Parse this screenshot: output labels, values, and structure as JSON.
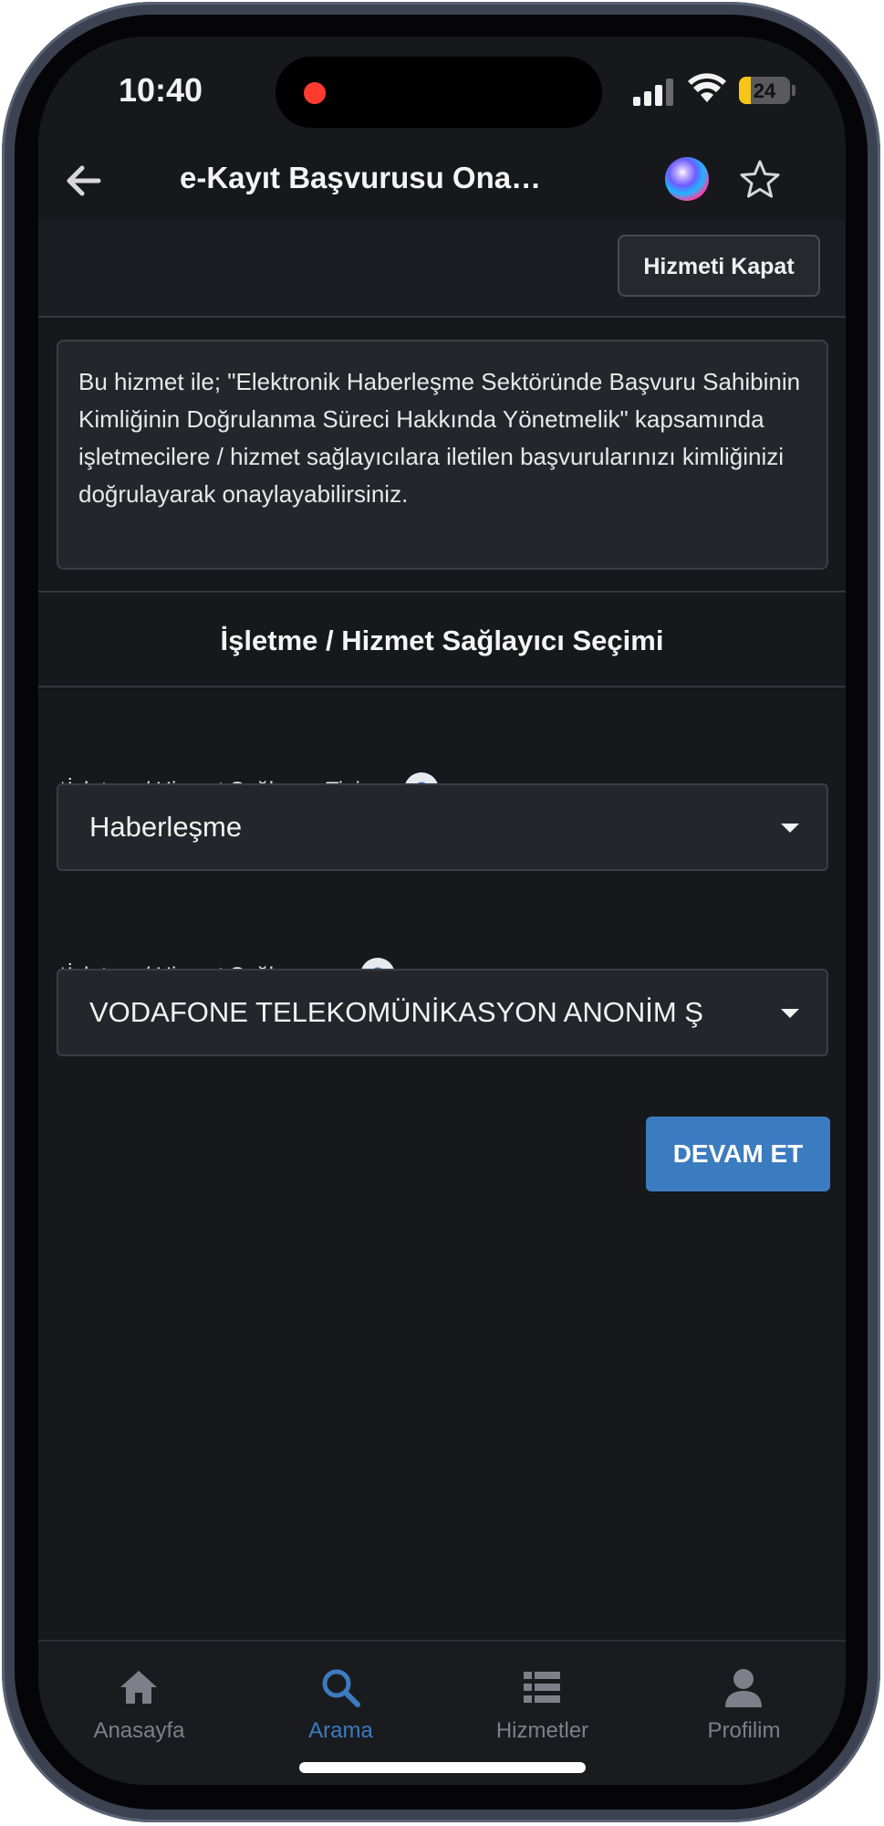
{
  "status_bar": {
    "time": "10:40",
    "battery_level": "24",
    "battery_fraction": 0.24,
    "recording_color": "#ff3b30"
  },
  "header": {
    "title": "e-Kayıt Başvurusu Onay İşl...",
    "back_icon": "arrow-left-icon",
    "assistant_icon": "siri-icon",
    "favorite_icon": "star-outline-icon"
  },
  "toolbar": {
    "close_service_label": "Hizmeti Kapat"
  },
  "info": {
    "text": "Bu hizmet ile; \"Elektronik Haberleşme Sektöründe Başvuru Sahibinin Kimliğinin Doğrulanma Süreci Hakkında Yönetmelik\" kapsamında işletmecilere / hizmet sağlayıcılara iletilen başvurularınızı kimliğinizi doğrulayarak onaylayabilirsiniz."
  },
  "section": {
    "title": "İşletme / Hizmet Sağlayıcı Seçimi"
  },
  "form": {
    "provider_type": {
      "label": "*İşletme / Hizmet Sağlayıcı Tipi",
      "help": "?",
      "selected": "Haberleşme"
    },
    "provider": {
      "label": "*İşletme / Hizmet Sağlayıcı",
      "help": "?",
      "selected": "VODAFONE TELEKOMÜNİKASYON ANONİM Ş"
    },
    "continue_label": "DEVAM ET"
  },
  "tabbar": {
    "active_color": "#3b7bc0",
    "items": [
      {
        "label": "Anasayfa",
        "icon": "home-icon"
      },
      {
        "label": "Arama",
        "icon": "search-icon"
      },
      {
        "label": "Hizmetler",
        "icon": "list-icon"
      },
      {
        "label": "Profilim",
        "icon": "user-icon"
      }
    ]
  }
}
